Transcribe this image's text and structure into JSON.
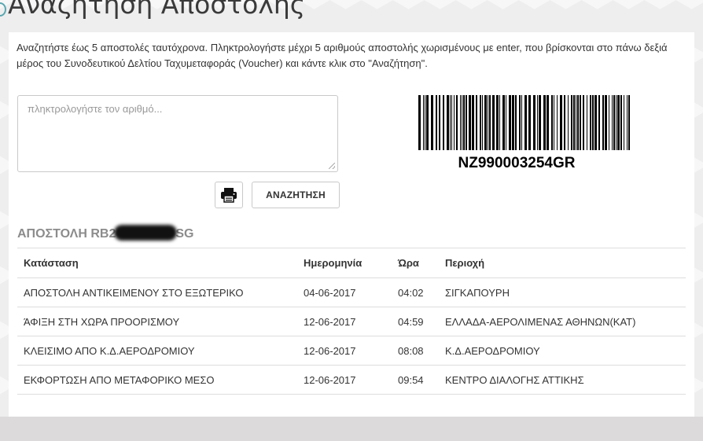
{
  "page": {
    "title": "Αναζήτηση Αποστολής",
    "intro": "Αναζητήστε έως 5 αποστολές ταυτόχρονα. Πληκτρολογήστε μέχρι 5 αριθμούς αποστολής χωρισμένους με enter, που βρίσκονται στο πάνω δεξιά μέρος του Συνοδευτικού Δελτίου Ταχυμεταφοράς (Voucher) και κάντε κλικ στο \"Αναζήτηση\"."
  },
  "search": {
    "placeholder": "πληκτρολογήστε τον αριθμό...",
    "value": "",
    "print_icon": "print-icon",
    "button_label": "ΑΝΑΖΗΤΗΣΗ"
  },
  "barcode": {
    "number": "NZ990003254GR"
  },
  "shipment": {
    "heading_prefix": "ΑΠΟΣΤΟΛΗ RB2",
    "heading_suffix": "SG",
    "columns": [
      "Κατάσταση",
      "Ημερομηνία",
      "Ώρα",
      "Περιοχή"
    ],
    "rows": [
      [
        "ΑΠΟΣΤΟΛΗ ΑΝΤΙΚΕΙΜΕΝΟΥ ΣΤΟ ΕΞΩΤΕΡΙΚΟ",
        "04-06-2017",
        "04:02",
        "ΣΙΓΚΑΠΟΥΡΗ"
      ],
      [
        "ΆΦΙΞΗ ΣΤΗ ΧΩΡΑ ΠΡΟΟΡΙΣΜΟΥ",
        "12-06-2017",
        "04:59",
        "ΕΛΛΑΔΑ-ΑΕΡΟΛΙΜΕΝΑΣ ΑΘΗΝΩΝ(ΚΑΤ)"
      ],
      [
        "ΚΛΕΙΣΙΜΟ ΑΠΟ Κ.Δ.ΑΕΡΟΔΡΟΜΙΟΥ",
        "12-06-2017",
        "08:08",
        "Κ.Δ.ΑΕΡΟΔΡΟΜΙΟΥ"
      ],
      [
        "ΕΚΦΟΡΤΩΣΗ ΑΠΟ ΜΕΤΑΦΟΡΙΚΟ ΜΕΣΟ",
        "12-06-2017",
        "09:54",
        "ΚΕΝΤΡΟ ΔΙΑΛΟΓΗΣ ΑΤΤΙΚΗΣ"
      ]
    ]
  },
  "colors": {
    "heading_gray": "#8c8c8c",
    "border": "#dddddd",
    "panel": "#ffffff"
  }
}
